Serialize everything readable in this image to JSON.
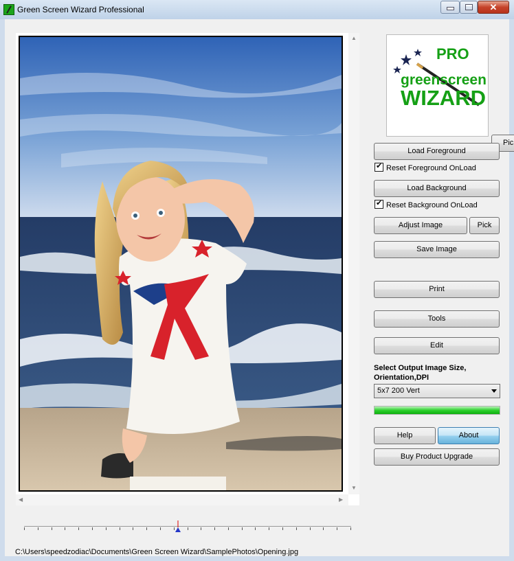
{
  "window": {
    "title": "Green Screen Wizard Professional"
  },
  "logo": {
    "pro": "PRO",
    "line1": "greenscreen",
    "line2": "WIZARD"
  },
  "buttons": {
    "pick_partial": "Pic",
    "load_foreground": "Load Foreground",
    "load_background": "Load Background",
    "adjust_image": "Adjust Image",
    "pick": "Pick",
    "save_image": "Save Image",
    "print": "Print",
    "tools": "Tools",
    "edit": "Edit",
    "help": "Help",
    "about": "About",
    "buy_upgrade": "Buy Product Upgrade"
  },
  "checkboxes": {
    "reset_foreground": {
      "label": "Reset Foreground OnLoad",
      "checked": true
    },
    "reset_background": {
      "label": "Reset Background OnLoad",
      "checked": true
    }
  },
  "output": {
    "label_line1": "Select Output Image Size,",
    "label_line2": "Orientation,DPI",
    "selected": "5x7 200 Vert"
  },
  "progress": {
    "value": 1.0,
    "color": "#1fc41f"
  },
  "slider": {
    "position": 0.47
  },
  "status": {
    "path": "C:\\Users\\speedzodiac\\Documents\\Green Screen Wizard\\SamplePhotos\\Opening.jpg"
  },
  "colors": {
    "brand_green": "#15a015",
    "accent_blue": "#3c7fb1",
    "close_red": "#c6432a"
  }
}
